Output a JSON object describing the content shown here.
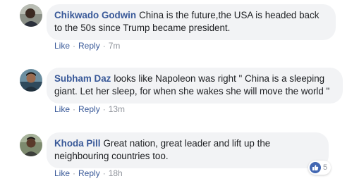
{
  "comments": [
    {
      "author": "Chikwado Godwin",
      "text": "China is the future,the USA is headed back to the 50s since Trump became president.",
      "like_label": "Like",
      "reply_label": "Reply",
      "time": "7m"
    },
    {
      "author": "Subham Daz",
      "text": "looks like Napoleon was right \" China is a sleeping giant. Let her sleep, for when she wakes she will move the world \"",
      "like_label": "Like",
      "reply_label": "Reply",
      "time": "13m"
    },
    {
      "author": "Khoda Pill",
      "text": "Great nation, great leader and lift up the neighbouring countries too.",
      "like_label": "Like",
      "reply_label": "Reply",
      "time": "18h",
      "reaction_count": "5",
      "reaction_icon": "thumbs-up-icon"
    }
  ],
  "colors": {
    "author": "#385898",
    "bubble": "#f2f3f5",
    "meta": "#90949c",
    "like_badge": "#4267b2"
  }
}
